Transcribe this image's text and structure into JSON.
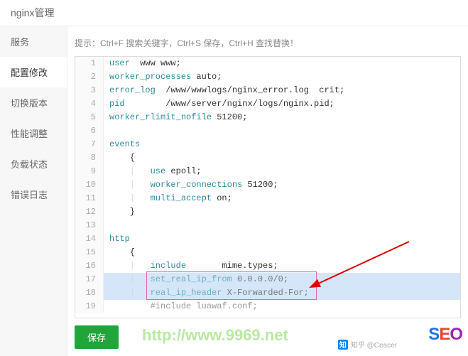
{
  "header": {
    "title": "nginx管理"
  },
  "sidebar": {
    "items": [
      {
        "label": "服务"
      },
      {
        "label": "配置修改"
      },
      {
        "label": "切换版本"
      },
      {
        "label": "性能调整"
      },
      {
        "label": "负载状态"
      },
      {
        "label": "错误日志"
      }
    ]
  },
  "hint": "提示：Ctrl+F 搜索关键字，Ctrl+S 保存，Ctrl+H 查找替换！",
  "save_button": "保存",
  "watermark": "http://www.9969.net",
  "zhihu_user": "知乎 @Ceacer",
  "seo_text": {
    "s": "S",
    "e": "E",
    "o": "O"
  },
  "code": {
    "ln1": "1",
    "cc1a": "user",
    "cc1b": "  www www;",
    "ln2": "2",
    "cc2a": "worker_processes",
    "cc2b": " auto;",
    "ln3": "3",
    "cc3a": "error_log",
    "cc3b": "  /www/wwwlogs/nginx_error.log  crit;",
    "ln4": "4",
    "cc4a": "pid",
    "cc4b": "        /www/server/nginx/logs/nginx.pid;",
    "ln5": "5",
    "cc5a": "worker_rlimit_nofile",
    "cc5b": " 51200;",
    "ln6": "6",
    "ln7": "7",
    "cc7a": "events",
    "ln8": "8",
    "cc8": "    {",
    "ln9": "9",
    "cc9g": "    |   ",
    "cc9a": "use",
    "cc9b": " epoll;",
    "ln10": "10",
    "cc10g": "    |   ",
    "cc10a": "worker_connections",
    "cc10b": " 51200;",
    "ln11": "11",
    "cc11g": "    |   ",
    "cc11a": "multi_accept",
    "cc11b": " on;",
    "ln12": "12",
    "cc12": "    }",
    "ln13": "13",
    "ln14": "14",
    "cc14a": "http",
    "ln15": "15",
    "cc15": "    {",
    "ln16": "16",
    "cc16g": "    |   ",
    "cc16a": "include",
    "cc16b": "       mime.types;",
    "ln17": "17",
    "cc17g": "    |   ",
    "cc17a": "set_real_ip_from",
    "cc17b": " 0.0.0.0/0;",
    "ln18": "18",
    "cc18g": "    |   ",
    "cc18a": "real_ip_header",
    "cc18b": " X-Forwarded-For;",
    "ln19": "19",
    "cc19g": "        ",
    "cc19": "#include luawaf.conf;"
  }
}
